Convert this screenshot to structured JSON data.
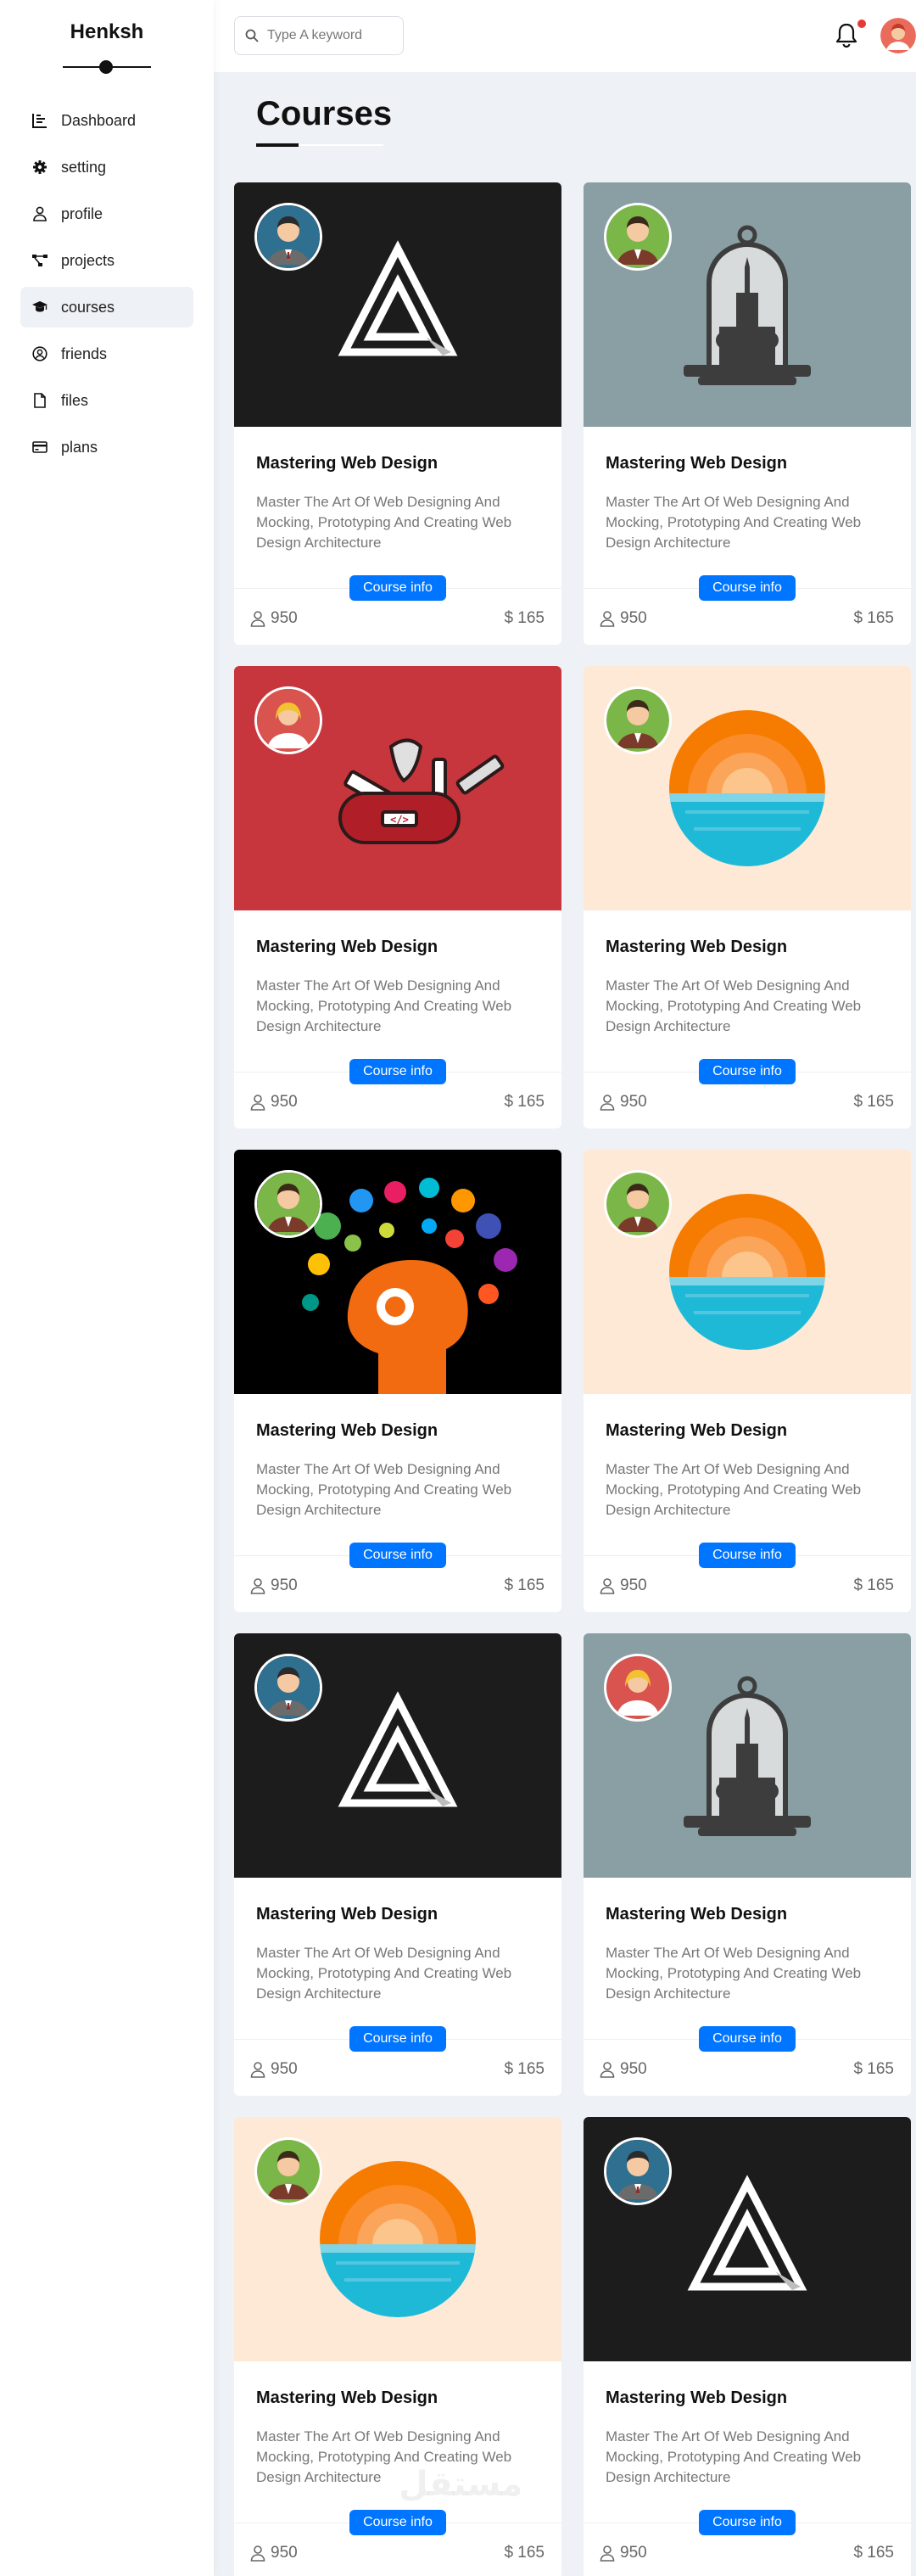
{
  "brand": {
    "name": "Henksh"
  },
  "sidebar": {
    "items": [
      {
        "label": "Dashboard",
        "icon": "chart-icon",
        "active": false
      },
      {
        "label": "setting",
        "icon": "gear-icon",
        "active": false
      },
      {
        "label": "profile",
        "icon": "user-icon",
        "active": false
      },
      {
        "label": "projects",
        "icon": "diagram-icon",
        "active": false
      },
      {
        "label": "courses",
        "icon": "graduation-cap-icon",
        "active": true
      },
      {
        "label": "friends",
        "icon": "user-circle-icon",
        "active": false
      },
      {
        "label": "files",
        "icon": "file-icon",
        "active": false
      },
      {
        "label": "plans",
        "icon": "credit-card-icon",
        "active": false
      }
    ]
  },
  "header": {
    "search_placeholder": "Type A keyword",
    "search_icon": "search-icon",
    "notifications_icon": "bell-icon",
    "notification_dot_color": "#e53935"
  },
  "main": {
    "title": "Courses"
  },
  "colors": {
    "accent": "#0075ff",
    "background": "#eef1f5"
  },
  "courses": [
    {
      "title": "Mastering Web Design",
      "description": "Master The Art Of Web Designing And Mocking, Prototyping And Creating Web Design Architecture",
      "button": "Course info",
      "students": "950",
      "price": "$ 165",
      "image": "logo-a"
    },
    {
      "title": "Mastering Web Design",
      "description": "Master The Art Of Web Designing And Mocking, Prototyping And Creating Web Design Architecture",
      "button": "Course info",
      "students": "950",
      "price": "$ 165",
      "image": "cathedral-dome"
    },
    {
      "title": "Mastering Web Design",
      "description": "Master The Art Of Web Designing And Mocking, Prototyping And Creating Web Design Architecture",
      "button": "Course info",
      "students": "950",
      "price": "$ 165",
      "image": "social-knife"
    },
    {
      "title": "Mastering Web Design",
      "description": "Master The Art Of Web Designing And Mocking, Prototyping And Creating Web Design Architecture",
      "button": "Course info",
      "students": "950",
      "price": "$ 165",
      "image": "sunset"
    },
    {
      "title": "Mastering Web Design",
      "description": "Master The Art Of Web Designing And Mocking, Prototyping And Creating Web Design Architecture",
      "button": "Course info",
      "students": "950",
      "price": "$ 165",
      "image": "head-icons"
    },
    {
      "title": "Mastering Web Design",
      "description": "Master The Art Of Web Designing And Mocking, Prototyping And Creating Web Design Architecture",
      "button": "Course info",
      "students": "950",
      "price": "$ 165",
      "image": "sunset"
    },
    {
      "title": "Mastering Web Design",
      "description": "Master The Art Of Web Designing And Mocking, Prototyping And Creating Web Design Architecture",
      "button": "Course info",
      "students": "950",
      "price": "$ 165",
      "image": "logo-a"
    },
    {
      "title": "Mastering Web Design",
      "description": "Master The Art Of Web Designing And Mocking, Prototyping And Creating Web Design Architecture",
      "button": "Course info",
      "students": "950",
      "price": "$ 165",
      "image": "cathedral-dome"
    },
    {
      "title": "Mastering Web Design",
      "description": "Master The Art Of Web Designing And Mocking, Prototyping And Creating Web Design Architecture",
      "button": "Course info",
      "students": "950",
      "price": "$ 165",
      "image": "sunset"
    },
    {
      "title": "Mastering Web Design",
      "description": "Master The Art Of Web Designing And Mocking, Prototyping And Creating Web Design Architecture",
      "button": "Course info",
      "students": "950",
      "price": "$ 165",
      "image": "logo-a"
    }
  ],
  "watermark": "مستقل"
}
